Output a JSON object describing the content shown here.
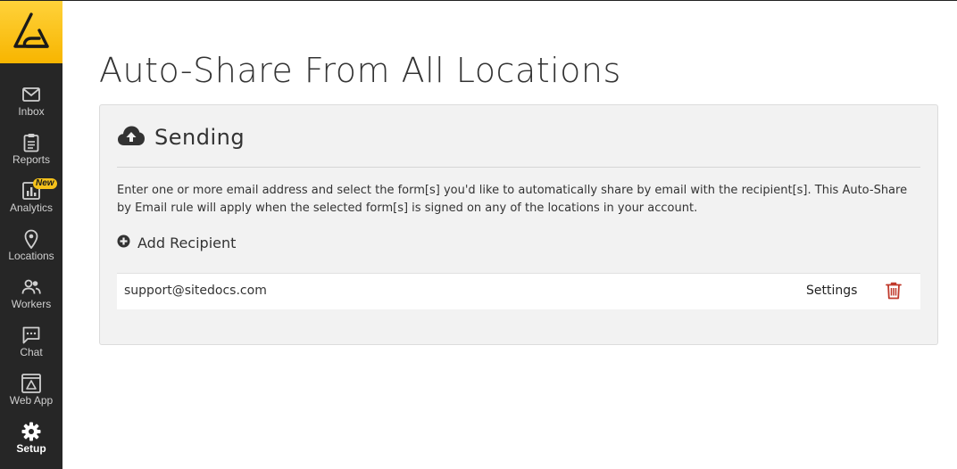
{
  "sidebar": {
    "logo_icon": "sitedocs-logo",
    "items": [
      {
        "label": "Inbox",
        "icon": "envelope-icon"
      },
      {
        "label": "Reports",
        "icon": "clipboard-icon"
      },
      {
        "label": "Analytics",
        "icon": "bar-chart-icon",
        "badge": "New"
      },
      {
        "label": "Locations",
        "icon": "map-pin-icon"
      },
      {
        "label": "Workers",
        "icon": "people-icon"
      },
      {
        "label": "Chat",
        "icon": "chat-bubble-icon"
      },
      {
        "label": "Web App",
        "icon": "web-app-icon"
      },
      {
        "label": "Setup",
        "icon": "gear-icon",
        "active": true
      }
    ],
    "colors": {
      "background": "#262626",
      "logo": "#ffc61a",
      "badge": "#f5c21b"
    }
  },
  "main": {
    "title": "Auto-Share From All Locations",
    "card": {
      "header_icon": "cloud-upload-icon",
      "header_title": "Sending",
      "description": "Enter one or more email address and select the form[s] you'd like to automatically share by email with the recipient[s]. This Auto-Share by Email rule will apply when the selected form[s] is signed on any of the locations in your account.",
      "add_recipient_label": "Add Recipient",
      "recipients": [
        {
          "email": "support@sitedocs.com",
          "settings_label": "Settings",
          "delete_icon": "trash-icon"
        }
      ]
    }
  },
  "colors": {
    "delete": "#c0392b",
    "card_background": "#f2f2f2"
  }
}
